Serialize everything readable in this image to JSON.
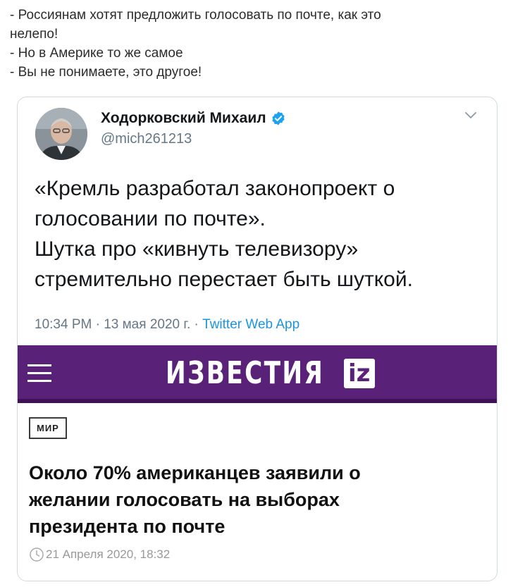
{
  "caption": {
    "lines": [
      "- Россиянам хотят предложить голосовать по почте, как это",
      "нелепо!",
      "- Но в Америке то же самое",
      "- Вы не понимаете, это другое!"
    ]
  },
  "tweet": {
    "author_name": "Ходорковский Михаил",
    "handle": "@mich261213",
    "text_lines": [
      "«Кремль разработал законопроект о",
      "голосовании по почте».",
      "Шутка про «кивнуть телевизору»",
      "стремительно перестает быть шуткой."
    ],
    "time": "10:34 PM · 13 мая 2020 г. · ",
    "source": "Twitter Web App",
    "icons": {
      "verified": "verified-badge-icon",
      "menu": "chevron-down-icon"
    },
    "colors": {
      "verified": "#1da1f2",
      "source_link": "#1b95e0"
    }
  },
  "izvestia": {
    "logo_text": "ИЗВЕСТИЯ",
    "logo_badge": "iz",
    "header_color": "#5a2178",
    "category": "МИР",
    "headline_lines": [
      "Около 70% американцев заявили о",
      "желании голосовать на выборах",
      "президента по почте"
    ],
    "date": "21 Апреля 2020, 18:32",
    "icons": {
      "menu": "hamburger-menu-icon",
      "date": "clock-icon"
    }
  }
}
